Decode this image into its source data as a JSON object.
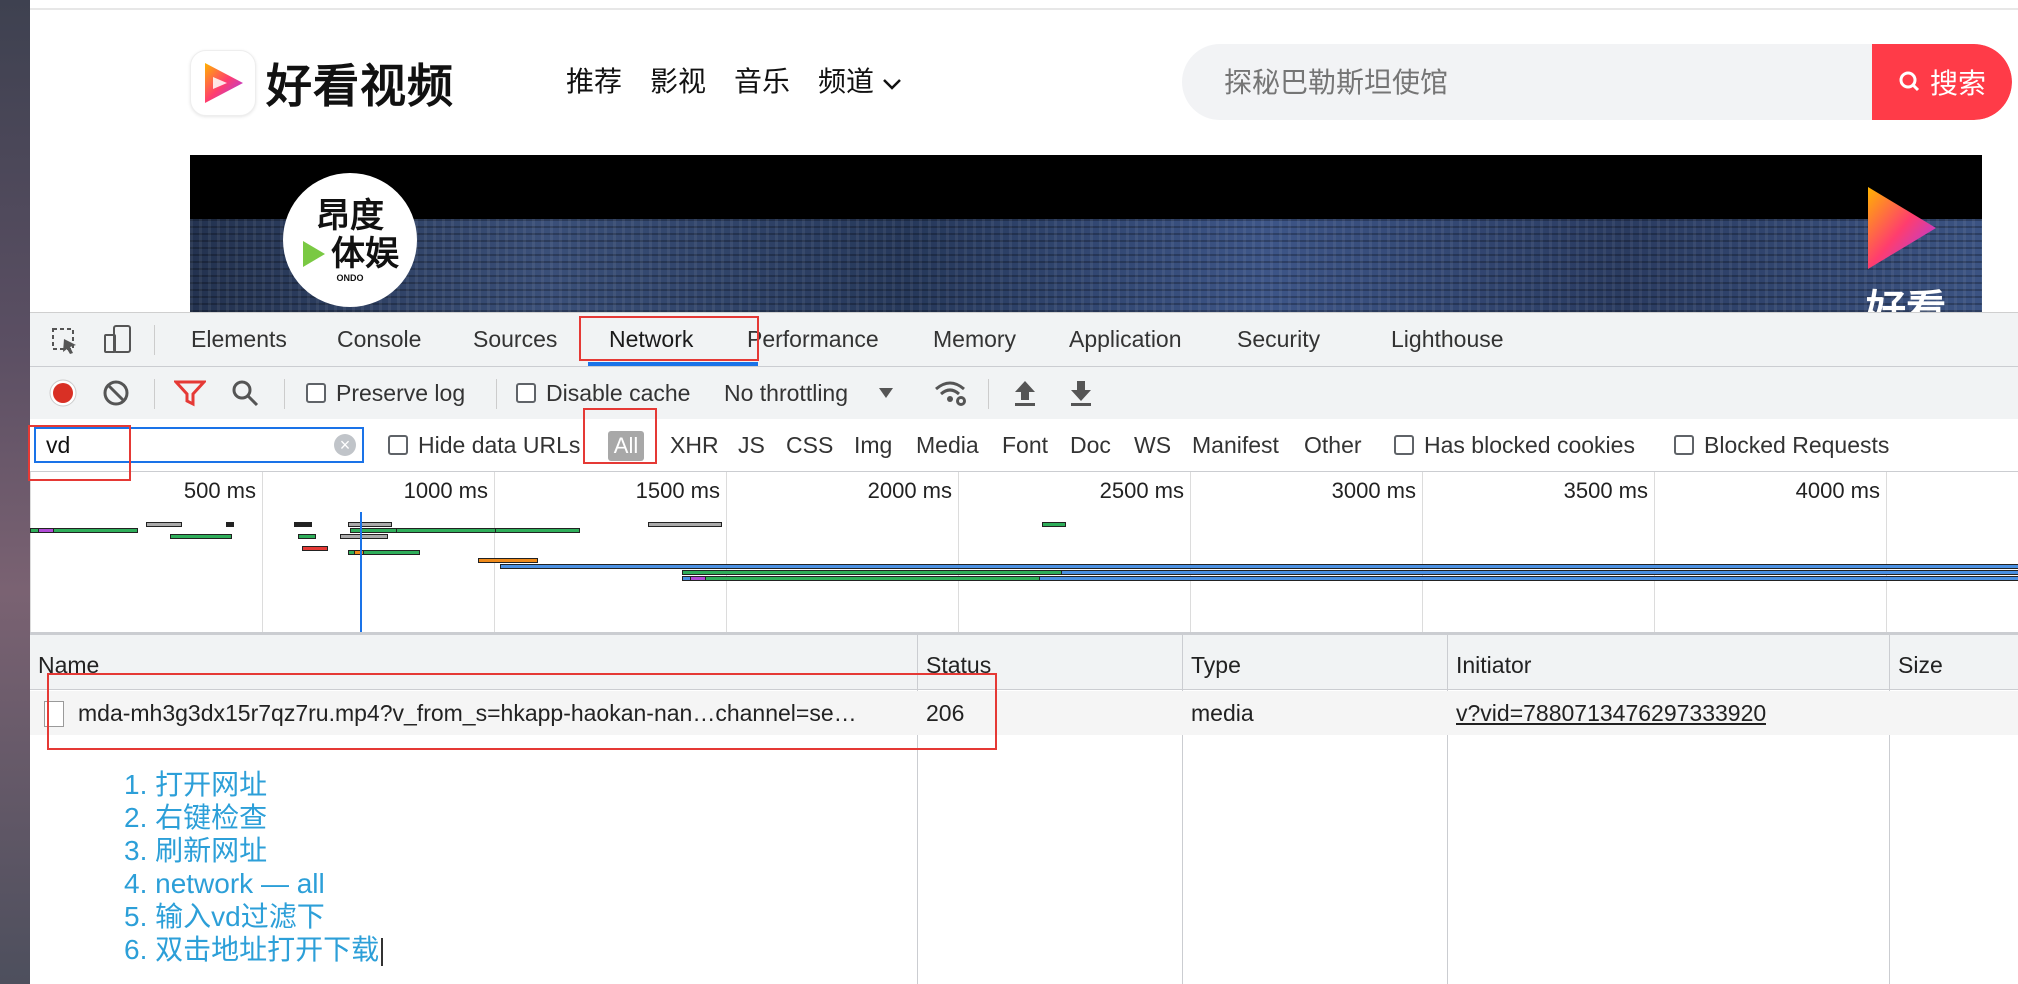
{
  "site": {
    "logo_text": "好看视频",
    "nav": [
      "推荐",
      "影视",
      "音乐",
      "频道"
    ],
    "search_placeholder": "探秘巴勒斯坦使馆",
    "search_button": "搜索",
    "video": {
      "channel_badge_line1": "昂度",
      "channel_badge_line2": "体娱",
      "channel_badge_small": "ONDO",
      "watermark_text": "好看"
    },
    "colors": {
      "accent": "#ff3b48"
    }
  },
  "devtools": {
    "tabs": [
      "Elements",
      "Console",
      "Sources",
      "Network",
      "Performance",
      "Memory",
      "Application",
      "Security",
      "Lighthouse"
    ],
    "active_tab": "Network",
    "toolbar": {
      "preserve_log": "Preserve log",
      "disable_cache": "Disable cache",
      "throttling": "No throttling"
    },
    "filter": {
      "value": "vd",
      "hide_data_urls": "Hide data URLs",
      "types": [
        "All",
        "XHR",
        "JS",
        "CSS",
        "Img",
        "Media",
        "Font",
        "Doc",
        "WS",
        "Manifest",
        "Other"
      ],
      "has_blocked_cookies": "Has blocked cookies",
      "blocked_requests": "Blocked Requests"
    },
    "timeline_ticks": [
      "500 ms",
      "1000 ms",
      "1500 ms",
      "2000 ms",
      "2500 ms",
      "3000 ms",
      "3500 ms",
      "4000 ms"
    ],
    "table": {
      "headers": {
        "name": "Name",
        "status": "Status",
        "type": "Type",
        "initiator": "Initiator",
        "size": "Size"
      },
      "rows": [
        {
          "name": "mda-mh3g3dx15r7qz7ru.mp4?v_from_s=hkapp-haokan-nan…channel=se…",
          "status": "206",
          "type": "media",
          "initiator": "v?vid=7880713476297333920"
        }
      ]
    }
  },
  "notes": [
    "1. 打开网址",
    "2. 右键检查",
    "3. 刷新网址",
    "4. network — all",
    "5. 输入vd过滤下",
    "6. 双击地址打开下载"
  ]
}
